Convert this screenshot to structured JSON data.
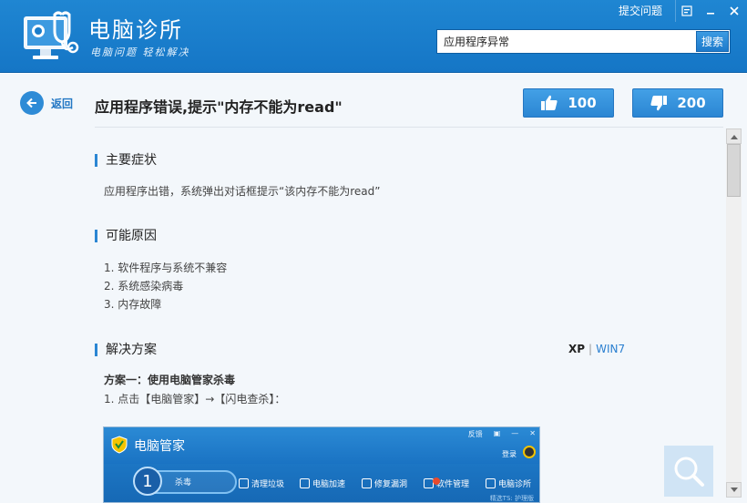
{
  "app": {
    "title": "电脑诊所",
    "slogan": "电脑问题 轻松解决"
  },
  "top_bar": {
    "submit_label": "提交问题"
  },
  "search": {
    "value": "应用程序异常",
    "button_label": "搜索"
  },
  "nav": {
    "back_label": "返回"
  },
  "article": {
    "title": "应用程序错误,提示\"内存不能为read\"",
    "likes": "100",
    "dislikes": "200",
    "symptoms_heading": "主要症状",
    "symptoms_text": "应用程序出错，系统弹出对话框提示“该内存不能为read”",
    "causes_heading": "可能原因",
    "causes": [
      "1. 软件程序与系统不兼容",
      "2. 系统感染病毒",
      "3. 内存故障"
    ],
    "solution_heading": "解决方案",
    "os_xp": "XP",
    "os_sep": "|",
    "os_win7": "WIN7",
    "method_one": "方案一：使用电脑管家杀毒",
    "step_one": "1. 点击【电脑管家】→【闪电查杀】："
  },
  "screenshot": {
    "title": "电脑管家",
    "ctrl": [
      "反馈",
      "▣",
      "—",
      "✕"
    ],
    "login": "登录",
    "step_number": "1",
    "kill_label": "杀毒",
    "tabs": [
      "清理垃圾",
      "电脑加速",
      "修复漏洞",
      "软件管理",
      "电脑诊所"
    ],
    "status": "精选TS: 护理版"
  },
  "colors": {
    "header_blue": "#1a7dcb",
    "accent_blue": "#2b86d3",
    "content_bg": "#f3f7fb"
  }
}
